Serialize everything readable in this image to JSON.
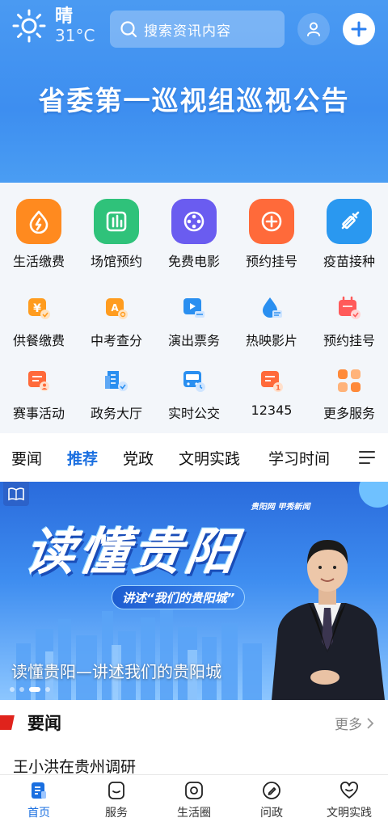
{
  "header": {
    "weather_condition": "晴",
    "temperature": "31°C",
    "search_placeholder": "搜索资讯内容",
    "banner_title": "省委第一巡视组巡视公告"
  },
  "services_primary": [
    {
      "label": "生活缴费",
      "color": "#ff8a1f",
      "icon": "flame-icon"
    },
    {
      "label": "场馆预约",
      "color": "#2fc27a",
      "icon": "building-icon"
    },
    {
      "label": "免费电影",
      "color": "#6a5cf0",
      "icon": "film-reel-icon"
    },
    {
      "label": "预约挂号",
      "color": "#ff6a3a",
      "icon": "medical-cross-icon"
    },
    {
      "label": "疫苗接种",
      "color": "#2a98f0",
      "icon": "syringe-icon"
    }
  ],
  "services_secondary_1": [
    {
      "label": "供餐缴费",
      "color": "#ff9c1f",
      "icon": "yuan-icon"
    },
    {
      "label": "中考查分",
      "color": "#ff9c1f",
      "icon": "grade-icon"
    },
    {
      "label": "演出票务",
      "color": "#2a8ff0",
      "icon": "ticket-icon"
    },
    {
      "label": "热映影片",
      "color": "#2a8ff0",
      "icon": "drop-icon"
    },
    {
      "label": "预约挂号",
      "color": "#ff5a5a",
      "icon": "calendar-icon"
    }
  ],
  "services_secondary_2": [
    {
      "label": "赛事活动",
      "color": "#ff6a3a",
      "icon": "event-icon"
    },
    {
      "label": "政务大厅",
      "color": "#2a8ff0",
      "icon": "hall-icon"
    },
    {
      "label": "实时公交",
      "color": "#2a8ff0",
      "icon": "bus-icon"
    },
    {
      "label": "12345",
      "color": "#ff6a3a",
      "icon": "hotline-icon"
    },
    {
      "label": "更多服务",
      "color": "#ff8a3a",
      "icon": "grid-icon"
    }
  ],
  "tabs": [
    "要闻",
    "推荐",
    "党政",
    "文明实践",
    "学习时间"
  ],
  "active_tab": "推荐",
  "carousel": {
    "big_title": "读懂贵阳",
    "subtitle": "讲述“我们的贵阳城”",
    "logo_text": "贵阳网 甲秀新闻",
    "caption": "读懂贵阳—讲述我们的贵阳城",
    "dot_count": 4,
    "active_dot": 2
  },
  "news": {
    "title": "要闻",
    "more": "更多",
    "first_item": "王小洪在贵州调研"
  },
  "bottom_nav": [
    {
      "label": "首页",
      "icon": "home-doc-icon",
      "active": true
    },
    {
      "label": "服务",
      "icon": "service-icon",
      "active": false
    },
    {
      "label": "生活圈",
      "icon": "life-circle-icon",
      "active": false
    },
    {
      "label": "问政",
      "icon": "pen-icon",
      "active": false
    },
    {
      "label": "文明实践",
      "icon": "heart-icon",
      "active": false
    }
  ],
  "colors": {
    "accent_blue": "#1a6fe0",
    "header_blue": "#3d8ef0",
    "news_red": "#e0231c"
  }
}
